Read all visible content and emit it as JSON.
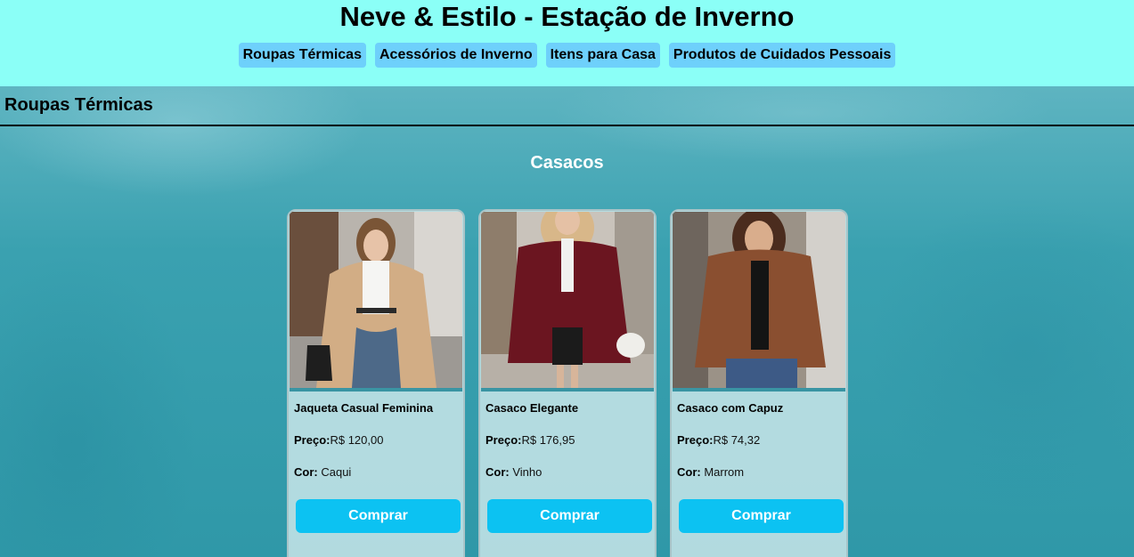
{
  "header": {
    "title": "Neve & Estilo - Estação de Inverno",
    "nav": [
      {
        "label": "Roupas Térmicas"
      },
      {
        "label": "Acessórios de Inverno"
      },
      {
        "label": "Itens para Casa"
      },
      {
        "label": "Produtos de Cuidados Pessoais"
      }
    ]
  },
  "section": {
    "title": "Roupas Térmicas",
    "category": "Casacos"
  },
  "labels": {
    "price": "Preço:",
    "color": "Cor:",
    "buy": "Comprar"
  },
  "products": [
    {
      "name": "Jaqueta Casual Feminina",
      "price": "R$ 120,00",
      "color": "Caqui",
      "coat_color": "#d2ad85"
    },
    {
      "name": "Casaco Elegante",
      "price": "R$ 176,95",
      "color": "Vinho",
      "coat_color": "#6b1520"
    },
    {
      "name": "Casaco com Capuz",
      "price": "R$ 74,32",
      "color": "Marrom",
      "coat_color": "#8a4f30"
    }
  ],
  "colors": {
    "header_bg": "#8bfff7",
    "nav_button": "#6ed0fb",
    "buy_button": "#0cc2f2"
  }
}
